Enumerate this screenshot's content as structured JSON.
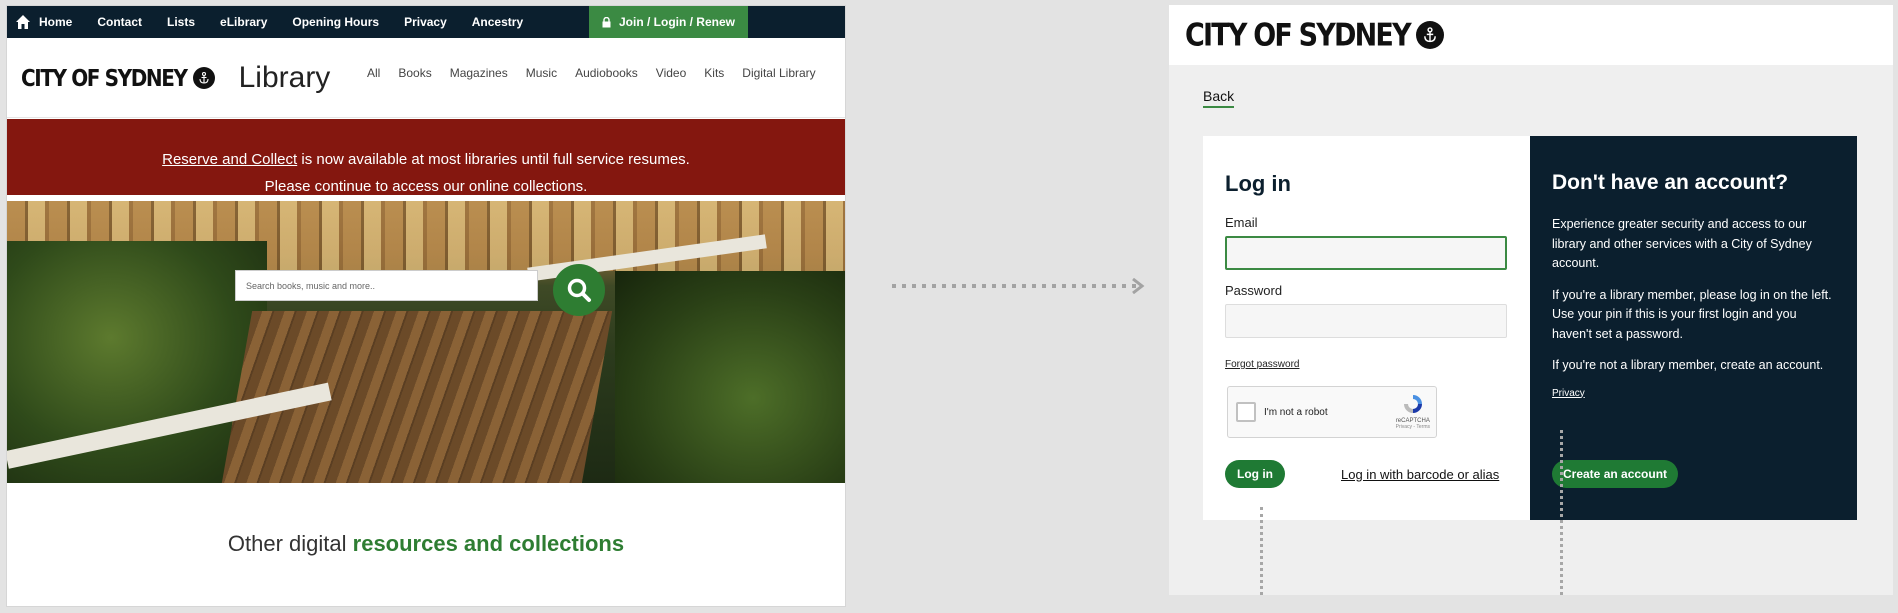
{
  "library": {
    "topnav": [
      "Home",
      "Contact",
      "Lists",
      "eLibrary",
      "Opening Hours",
      "Privacy",
      "Ancestry"
    ],
    "join_label": "Join / Login / Renew",
    "logo_text": "CITY OF SYDNEY",
    "title": "Library",
    "categories": [
      "All",
      "Books",
      "Magazines",
      "Music",
      "Audiobooks",
      "Video",
      "Kits",
      "Digital Library"
    ],
    "banner": {
      "link": "Reserve and Collect",
      "line1_rest": " is now available at most libraries until full service resumes.",
      "line2": "Please continue to access our online collections."
    },
    "search_placeholder": "Search books, music and more..",
    "resources": {
      "prefix": "Other digital ",
      "highlight": "resources and collections"
    }
  },
  "login": {
    "logo_text": "CITY OF SYDNEY",
    "back": "Back",
    "heading": "Log in",
    "email_label": "Email",
    "password_label": "Password",
    "forgot": "Forgot password",
    "captcha_text": "I'm not a robot",
    "captcha_brand": "reCAPTCHA",
    "captcha_terms": "Privacy - Terms",
    "login_button": "Log in",
    "barcode_link": "Log in with barcode or alias",
    "right_heading": "Don't have an account?",
    "para1": "Experience greater security and access to our library and other services with a City of Sydney account.",
    "para2": "If you're a library member, please log in on the left. Use your pin if this is your first login and you haven't set a password.",
    "para3": "If you're not a library member, create an account.",
    "privacy": "Privacy",
    "create_button": "Create an account"
  },
  "colors": {
    "navy": "#0b1f2e",
    "green": "#2e7d32",
    "banner_red": "#84170f"
  }
}
